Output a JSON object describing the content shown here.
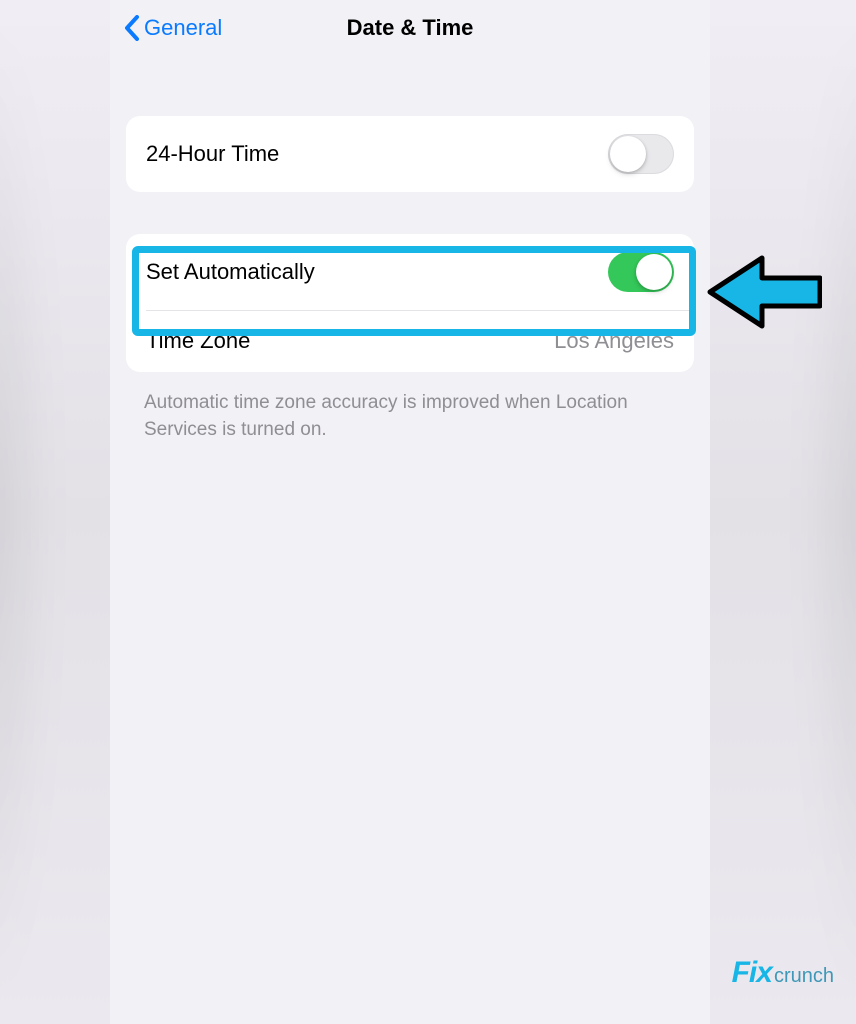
{
  "navbar": {
    "back_label": "General",
    "title": "Date & Time"
  },
  "group1": {
    "row_24h": {
      "label": "24-Hour Time",
      "on": false
    }
  },
  "group2": {
    "row_auto": {
      "label": "Set Automatically",
      "on": true
    },
    "row_tz": {
      "label": "Time Zone",
      "value": "Los Angeles"
    }
  },
  "footer_note": "Automatic time zone accuracy is improved when Location Services is turned on.",
  "watermark": {
    "brand": "Fix",
    "suffix": "crunch"
  },
  "colors": {
    "accent_blue": "#0a7aff",
    "switch_green": "#34c759",
    "highlight_cyan": "#17b6e6"
  }
}
